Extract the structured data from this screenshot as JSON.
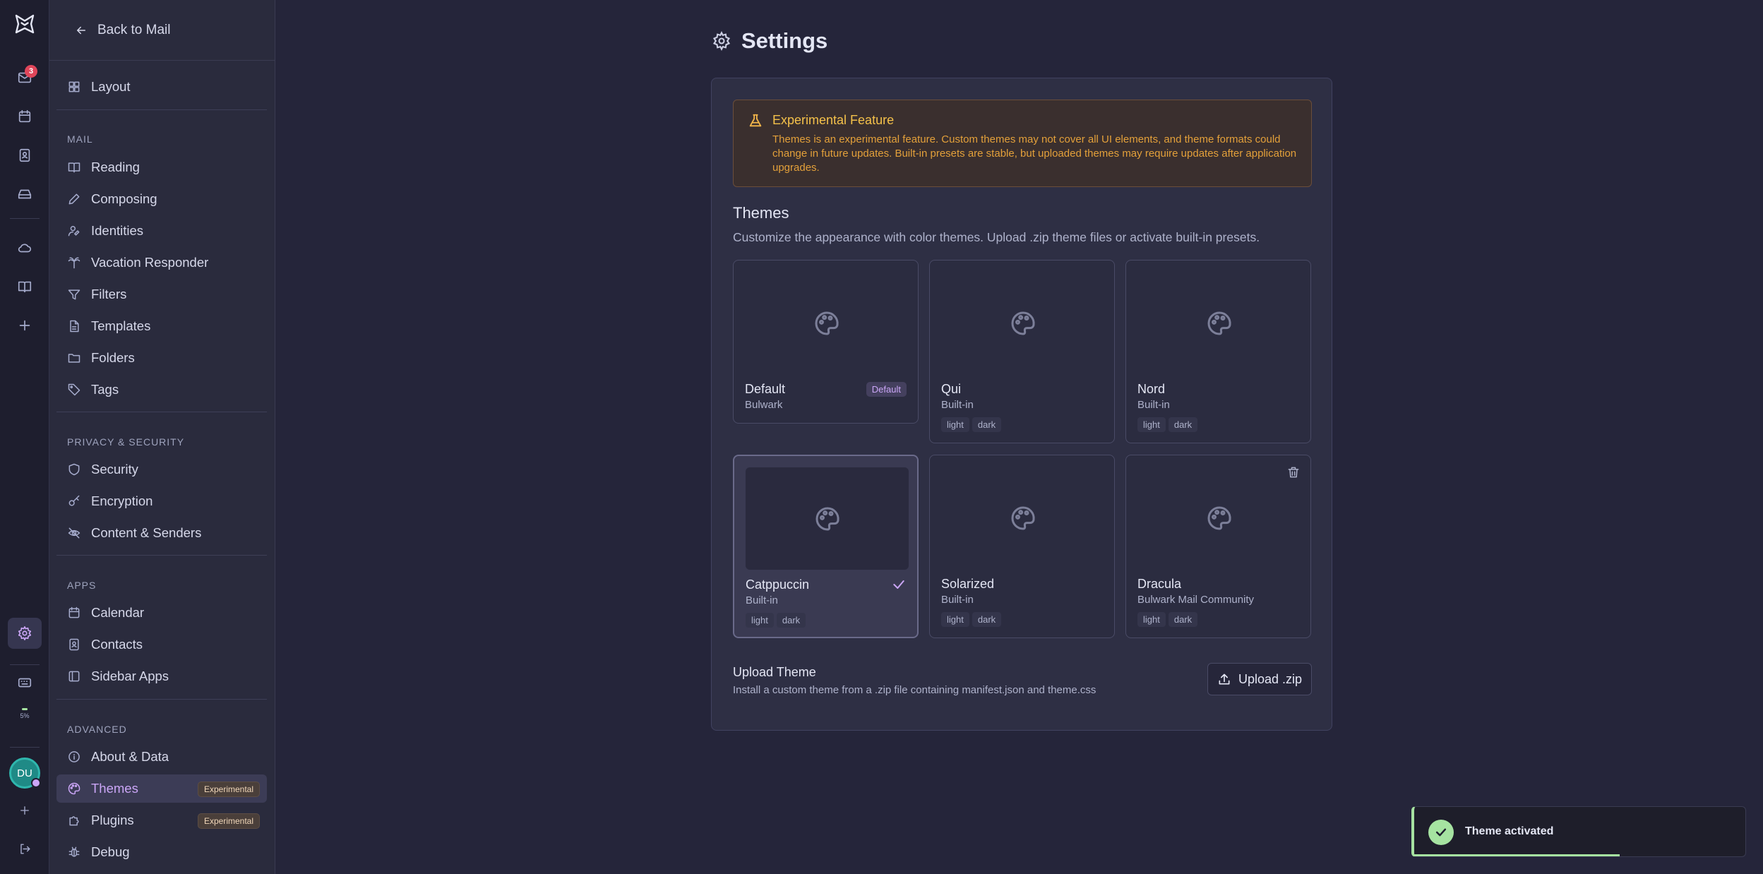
{
  "rail": {
    "mail_badge": "3",
    "storage_label": "5%",
    "avatar_initials": "DU"
  },
  "sidebar": {
    "back_label": "Back to Mail",
    "layout_label": "Layout",
    "mail_header": "MAIL",
    "mail_items": [
      "Reading",
      "Composing",
      "Identities",
      "Vacation Responder",
      "Filters",
      "Templates",
      "Folders",
      "Tags"
    ],
    "privacy_header": "PRIVACY & SECURITY",
    "privacy_items": [
      "Security",
      "Encryption",
      "Content & Senders"
    ],
    "apps_header": "APPS",
    "apps_items": [
      "Calendar",
      "Contacts",
      "Sidebar Apps"
    ],
    "advanced_header": "ADVANCED",
    "advanced_items": [
      "About & Data",
      "Themes",
      "Plugins",
      "Debug"
    ],
    "experimental_tag": "Experimental"
  },
  "main": {
    "title": "Settings",
    "warning": {
      "title": "Experimental Feature",
      "text": "Themes is an experimental feature. Custom themes may not cover all UI elements, and theme formats could change in future updates. Built-in presets are stable, but uploaded themes may require updates after application upgrades."
    },
    "themes_heading": "Themes",
    "themes_subtitle": "Customize the appearance with color themes. Upload .zip theme files or activate built-in presets.",
    "themes": [
      {
        "name": "Default",
        "author": "Bulwark",
        "badge": "Default",
        "tags": []
      },
      {
        "name": "Qui",
        "author": "Built-in",
        "tags": [
          "light",
          "dark"
        ]
      },
      {
        "name": "Nord",
        "author": "Built-in",
        "tags": [
          "light",
          "dark"
        ]
      },
      {
        "name": "Catppuccin",
        "author": "Built-in",
        "tags": [
          "light",
          "dark"
        ],
        "active": true
      },
      {
        "name": "Solarized",
        "author": "Built-in",
        "tags": [
          "light",
          "dark"
        ]
      },
      {
        "name": "Dracula",
        "author": "Bulwark Mail Community",
        "tags": [
          "light",
          "dark"
        ],
        "deletable": true
      }
    ],
    "upload": {
      "title": "Upload Theme",
      "subtitle": "Install a custom theme from a .zip file containing manifest.json and theme.css",
      "button_label": "Upload .zip"
    }
  },
  "toast": {
    "message": "Theme activated",
    "progress": 0.62
  },
  "colors": {
    "accent": "#cba6f7",
    "success": "#a6e3a1",
    "warning": "#f4c14a",
    "badge": "#e0465a"
  }
}
